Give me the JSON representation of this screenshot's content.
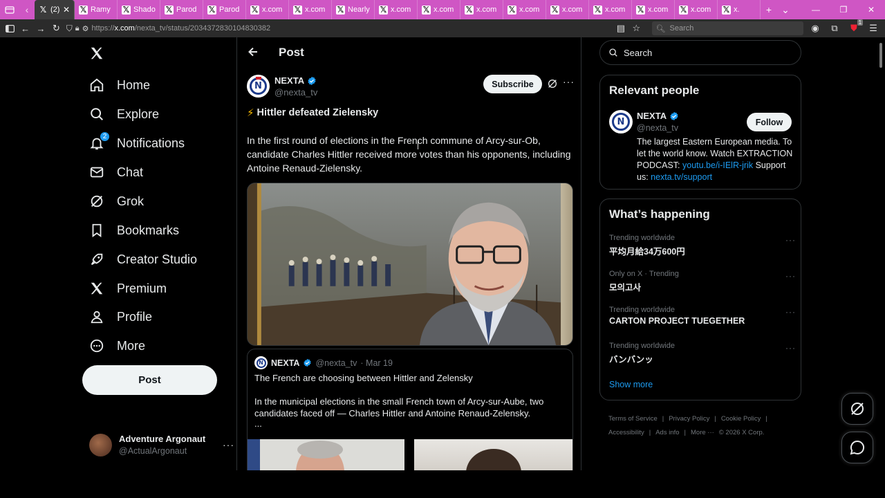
{
  "browser": {
    "tabs": [
      {
        "label": "(2)",
        "active": true
      },
      {
        "label": "Ramy"
      },
      {
        "label": "Shado"
      },
      {
        "label": "Parod"
      },
      {
        "label": "Parod"
      },
      {
        "label": "x.com"
      },
      {
        "label": "x.com"
      },
      {
        "label": "Nearly"
      },
      {
        "label": "x.com"
      },
      {
        "label": "x.com"
      },
      {
        "label": "x.com"
      },
      {
        "label": "x.com"
      },
      {
        "label": "x.com"
      },
      {
        "label": "x.com"
      },
      {
        "label": "x.com"
      },
      {
        "label": "x.com"
      },
      {
        "label": "x."
      }
    ],
    "url_prefix": "https://",
    "url_host": "x.com",
    "url_path": "/nexta_tv/status/2034372830104830382",
    "search_placeholder": "Search",
    "accent": "#cf56c4",
    "extension_badge": "1"
  },
  "sidebar": {
    "items": [
      {
        "label": "Home",
        "icon": "home-icon"
      },
      {
        "label": "Explore",
        "icon": "search-icon"
      },
      {
        "label": "Notifications",
        "icon": "bell-icon",
        "badge": "2"
      },
      {
        "label": "Chat",
        "icon": "mail-icon"
      },
      {
        "label": "Grok",
        "icon": "grok-icon"
      },
      {
        "label": "Bookmarks",
        "icon": "bookmark-icon"
      },
      {
        "label": "Creator Studio",
        "icon": "rocket-icon"
      },
      {
        "label": "Premium",
        "icon": "x-logo-icon"
      },
      {
        "label": "Profile",
        "icon": "person-icon"
      },
      {
        "label": "More",
        "icon": "more-circle-icon"
      }
    ],
    "post_button": "Post",
    "account": {
      "name": "Adventure Argonaut",
      "handle": "@ActualArgonaut"
    }
  },
  "main": {
    "title": "Post",
    "author": {
      "name": "NEXTA",
      "handle": "@nexta_tv"
    },
    "subscribe_label": "Subscribe",
    "headline": "Hittler defeated Zielensky",
    "body": "In the first round of elections in the French commune of Arcy-sur-Ob, candidate Charles Hittler received more votes than his opponents, including Antoine Renaud-Zielensky.",
    "quote": {
      "name": "NEXTA",
      "handle": "@nexta_tv",
      "date": "· Mar 19",
      "title": "The French are choosing between Hittler and Zelensky",
      "body": "In the municipal elections in the small French town of Arcy-sur-Aube, two candidates faced off — Charles Hittler and Antoine Renaud-Zelensky.",
      "ellipsis": "..."
    }
  },
  "right": {
    "search_placeholder": "Search",
    "relevant": {
      "title": "Relevant people",
      "name": "NEXTA",
      "handle": "@nexta_tv",
      "follow_label": "Follow",
      "bio_text": "The largest Eastern European media. To let the world know. Watch EXTRACTION PODCAST: ",
      "bio_link1": "youtu.be/i-IElR-jrik",
      "bio_mid": " Support us: ",
      "bio_link2": "nexta.tv/support"
    },
    "happening": {
      "title": "What’s happening",
      "trends": [
        {
          "meta": "Trending worldwide",
          "name": "平均月給34万600円"
        },
        {
          "meta": "Only on X · Trending",
          "name": "모의고사"
        },
        {
          "meta": "Trending worldwide",
          "name": "CARTON PROJECT TUEGETHER"
        },
        {
          "meta": "Trending worldwide",
          "name": "バンバンッ"
        }
      ],
      "show_more": "Show more"
    },
    "footer": {
      "line1": [
        "Terms of Service",
        "|",
        "Privacy Policy",
        "|",
        "Cookie Policy",
        "|"
      ],
      "line2": [
        "Accessibility",
        "|",
        "Ads info",
        "|",
        "More ···",
        "© 2026 X Corp."
      ]
    }
  },
  "colors": {
    "link": "#1d9bf0",
    "verified": "#1d9bf0",
    "muted": "#71767b",
    "border": "#2f3336"
  }
}
